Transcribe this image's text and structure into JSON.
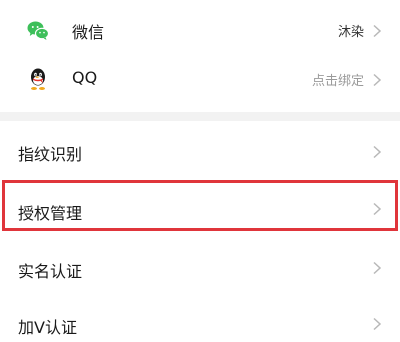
{
  "accounts": [
    {
      "name": "微信",
      "value": "沐染",
      "value_color": "#333333",
      "icon": "wechat-icon"
    },
    {
      "name": "QQ",
      "value": "点击绑定",
      "value_color": "#9a9a9a",
      "icon": "qq-icon"
    }
  ],
  "settings": [
    {
      "label": "指纹识别"
    },
    {
      "label": "授权管理",
      "highlighted": true
    },
    {
      "label": "实名认证"
    },
    {
      "label": "加V认证"
    }
  ],
  "colors": {
    "wechat_green": "#3dbf5a",
    "highlight_red": "#e0353b",
    "chevron": "#b8b8b8",
    "section_gap": "#f2f2f2"
  }
}
